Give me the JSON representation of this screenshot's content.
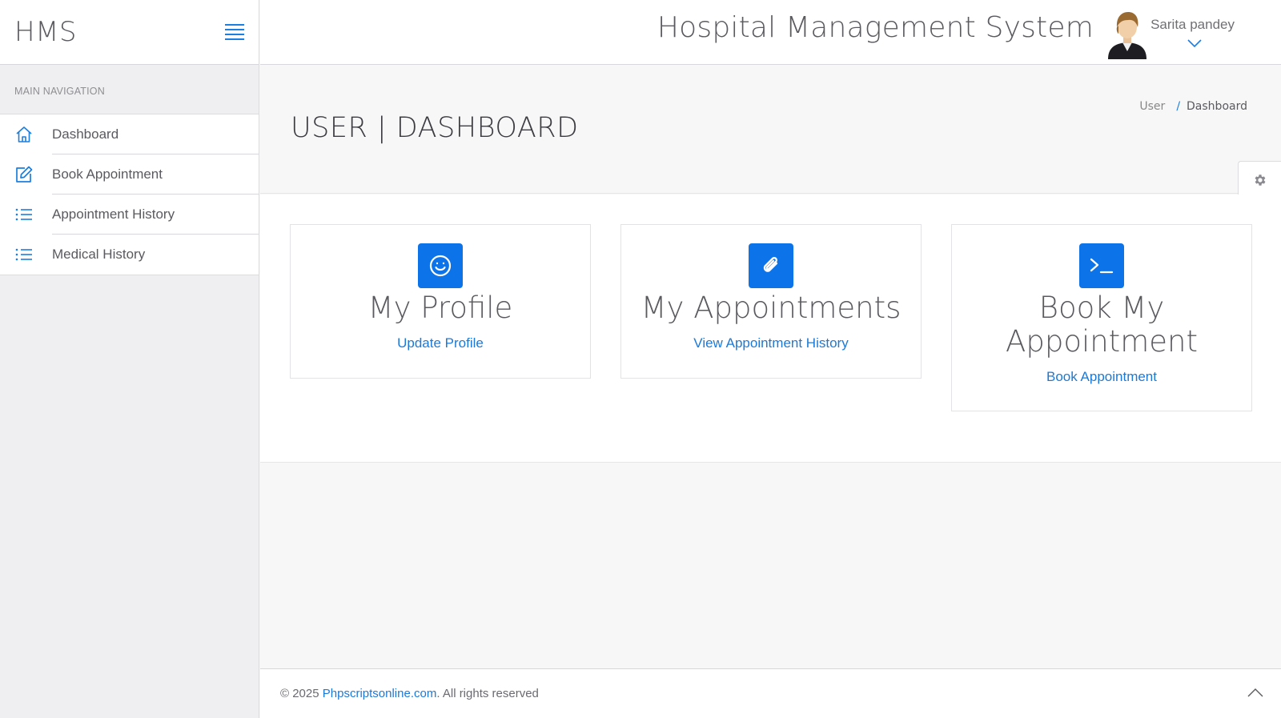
{
  "brand": {
    "name": "HMS"
  },
  "header": {
    "title": "Hospital Management System",
    "user_name": "Sarita pandey"
  },
  "sidebar": {
    "section_title": "MAIN NAVIGATION",
    "items": [
      {
        "label": "Dashboard",
        "icon": "home-icon"
      },
      {
        "label": "Book Appointment",
        "icon": "edit-icon"
      },
      {
        "label": "Appointment History",
        "icon": "list-icon"
      },
      {
        "label": "Medical History",
        "icon": "list-icon"
      }
    ]
  },
  "page": {
    "title": "USER | DASHBOARD",
    "breadcrumb": {
      "parent": "User",
      "separator": "/",
      "current": "Dashboard"
    }
  },
  "cards": [
    {
      "title": "My Profile",
      "link": "Update Profile",
      "icon": "smile-icon"
    },
    {
      "title": "My Appointments",
      "link": "View Appointment History",
      "icon": "paperclip-icon"
    },
    {
      "title_line1": "Book My",
      "title_line2": "Appointment",
      "link": "Book Appointment",
      "icon": "terminal-icon"
    }
  ],
  "footer": {
    "prefix": "© 2025 ",
    "link": "Phpscriptsonline.com",
    "suffix": ". All rights reserved"
  },
  "colors": {
    "accent": "#0d73e8",
    "link": "#1c79d6",
    "sidebar_bg": "#efeff1",
    "page_bg": "#f7f7f8"
  }
}
